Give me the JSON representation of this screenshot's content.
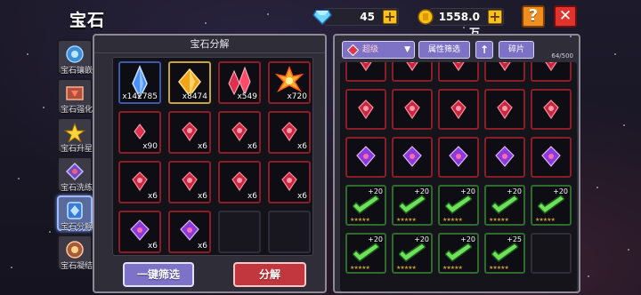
{
  "screen_title": "宝石",
  "resources": {
    "diamonds": {
      "value": "45",
      "icon": "diamond-icon"
    },
    "gold": {
      "value": "1558.0万",
      "icon": "gold-coin-icon"
    }
  },
  "top_buttons": {
    "help": "?",
    "close": "✕"
  },
  "sidebar": [
    {
      "label": "宝石镶嵌",
      "icon": "gem-inlay-icon"
    },
    {
      "label": "宝石强化",
      "icon": "gem-enhance-icon"
    },
    {
      "label": "宝石升星",
      "icon": "gem-star-icon"
    },
    {
      "label": "宝石洗练",
      "icon": "gem-refine-icon"
    },
    {
      "label": "宝石分解",
      "icon": "gem-decompose-icon",
      "active": true
    },
    {
      "label": "宝石凝结",
      "icon": "gem-condense-icon"
    }
  ],
  "left_panel": {
    "title": "宝石分解",
    "materials": [
      {
        "count": "x142785",
        "icon": "blue-crystal-icon",
        "frame": "blue"
      },
      {
        "count": "x8474",
        "icon": "gold-crystal-icon",
        "frame": "gold"
      },
      {
        "count": "x549",
        "icon": "red-crystal-icon",
        "frame": "red"
      },
      {
        "count": "x720",
        "icon": "fire-essence-icon",
        "frame": "red"
      },
      {
        "count": "x90",
        "icon": "red-shard-icon",
        "frame": "red"
      },
      {
        "count": "x6",
        "icon": "red-gem-icon",
        "frame": "red"
      },
      {
        "count": "x6",
        "icon": "red-gem-icon",
        "frame": "red"
      },
      {
        "count": "x6",
        "icon": "red-gem-icon",
        "frame": "red"
      },
      {
        "count": "x6",
        "icon": "red-gem-icon",
        "frame": "red"
      },
      {
        "count": "x6",
        "icon": "red-gem-icon",
        "frame": "red"
      },
      {
        "count": "x6",
        "icon": "red-gem-icon",
        "frame": "red"
      },
      {
        "count": "x6",
        "icon": "red-gem-icon",
        "frame": "red"
      },
      {
        "count": "x6",
        "icon": "purple-gem-icon",
        "frame": "red"
      },
      {
        "count": "x6",
        "icon": "purple-gem-icon",
        "frame": "red"
      },
      {
        "count": "",
        "icon": "",
        "frame": "empty"
      },
      {
        "count": "",
        "icon": "",
        "frame": "empty"
      }
    ],
    "quick_filter_button": "一键筛选",
    "decompose_button": "分解"
  },
  "right_panel": {
    "quality_filter": "超级",
    "attribute_filter": "属性筛选",
    "sort_arrow": "↑",
    "shard_button": "碎片",
    "capacity": "64/500",
    "rows": [
      [
        {
          "t": "red"
        },
        {
          "t": "red"
        },
        {
          "t": "red"
        },
        {
          "t": "red"
        },
        {
          "t": "red"
        }
      ],
      [
        {
          "t": "red"
        },
        {
          "t": "red"
        },
        {
          "t": "red"
        },
        {
          "t": "red"
        },
        {
          "t": "red"
        }
      ],
      [
        {
          "t": "red"
        },
        {
          "t": "red"
        },
        {
          "t": "red"
        },
        {
          "t": "red"
        },
        {
          "t": "red"
        }
      ],
      [
        {
          "t": "green",
          "lv": "+20",
          "stars": "★★★★★"
        },
        {
          "t": "green",
          "lv": "+20",
          "stars": "★★★★★"
        },
        {
          "t": "green",
          "lv": "+20",
          "stars": "★★★★★"
        },
        {
          "t": "green",
          "lv": "+20",
          "stars": "★★★★★"
        },
        {
          "t": "green",
          "lv": "+20",
          "stars": "★★★★★"
        }
      ],
      [
        {
          "t": "green",
          "lv": "+20",
          "stars": "★★★★★"
        },
        {
          "t": "green",
          "lv": "+20",
          "stars": "★★★★★"
        },
        {
          "t": "green",
          "lv": "+20",
          "stars": "★★★★★"
        },
        {
          "t": "green",
          "lv": "+25",
          "stars": "★★★★★"
        },
        {
          "t": "empty"
        }
      ]
    ]
  },
  "colors": {
    "accent_purple": "#7e72c6",
    "decompose_red": "#c2363d",
    "frame_red": "#8a1e28",
    "frame_gold": "#c8a23a"
  }
}
